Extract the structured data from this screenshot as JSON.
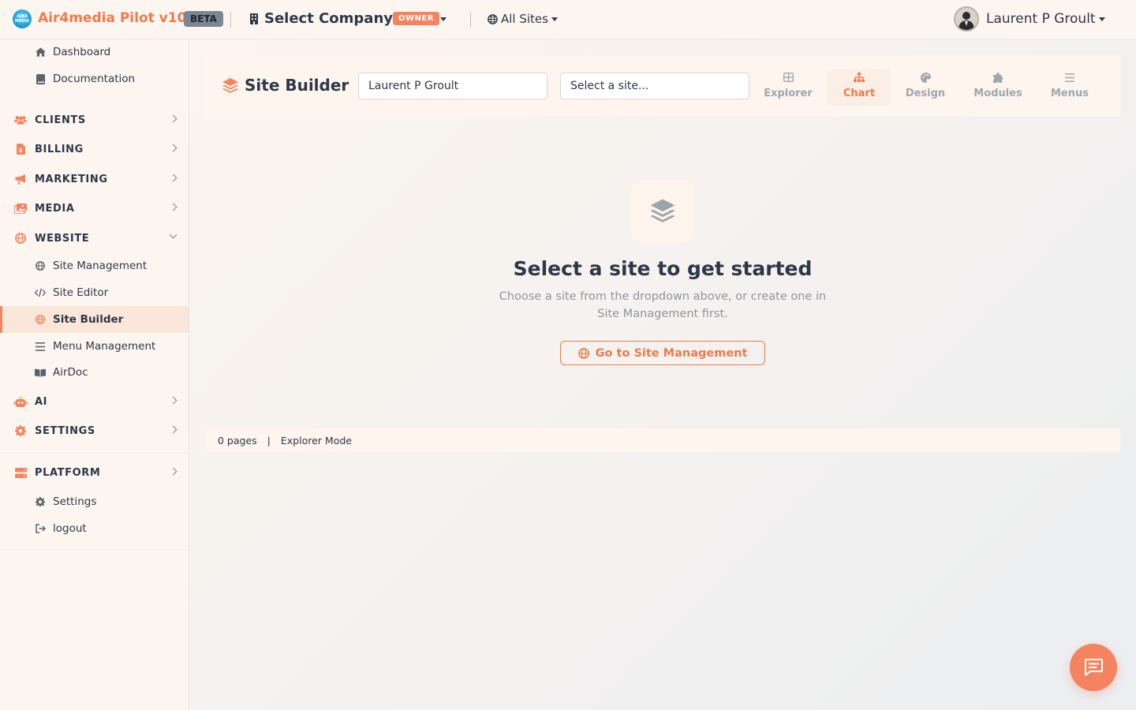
{
  "topbar": {
    "logo_text": "AIR4 MEDIA",
    "app_title": "Air4media Pilot v10",
    "beta_badge": "BETA",
    "company_label": "Select Company",
    "owner_badge": "OWNER",
    "sites_label": "All Sites",
    "user_name": "Laurent P Groult"
  },
  "sidebar": {
    "top_items": [
      {
        "label": "Dashboard",
        "icon": "home-icon"
      },
      {
        "label": "Documentation",
        "icon": "book-icon"
      }
    ],
    "sections": {
      "clients": "CLIENTS",
      "billing": "BILLING",
      "marketing": "MARKETING",
      "media": "MEDIA",
      "website": "WEBSITE",
      "ai": "AI",
      "settings": "SETTINGS",
      "platform": "PLATFORM"
    },
    "website_items": [
      {
        "label": "Site Management",
        "icon": "globe-icon"
      },
      {
        "label": "Site Editor",
        "icon": "code-icon"
      },
      {
        "label": "Site Builder",
        "icon": "globe-icon",
        "active": true
      },
      {
        "label": "Menu Management",
        "icon": "menu-icon"
      },
      {
        "label": "AirDoc",
        "icon": "open-book-icon"
      }
    ],
    "platform_items": [
      {
        "label": "Settings",
        "icon": "gear-icon"
      },
      {
        "label": "logout",
        "icon": "logout-icon"
      }
    ]
  },
  "builder": {
    "title": "Site Builder",
    "client_value": "Laurent P Groult",
    "site_placeholder": "Select a site...",
    "tabs": [
      {
        "label": "Explorer",
        "icon": "grid-icon"
      },
      {
        "label": "Chart",
        "icon": "sitemap-icon",
        "active": true
      },
      {
        "label": "Design",
        "icon": "palette-icon"
      },
      {
        "label": "Modules",
        "icon": "puzzle-icon"
      },
      {
        "label": "Menus",
        "icon": "bars-icon"
      }
    ]
  },
  "empty_state": {
    "title": "Select a site to get started",
    "description": "Choose a site from the dropdown above, or create one in Site Management first.",
    "button_label": "Go to Site Management"
  },
  "status_bar": {
    "pages": "0 pages",
    "separator": "|",
    "mode": "Explorer Mode"
  },
  "colors": {
    "accent": "#f4845f",
    "accent_text": "#f07a4a",
    "text": "#2d3748",
    "muted": "#8f959d"
  }
}
